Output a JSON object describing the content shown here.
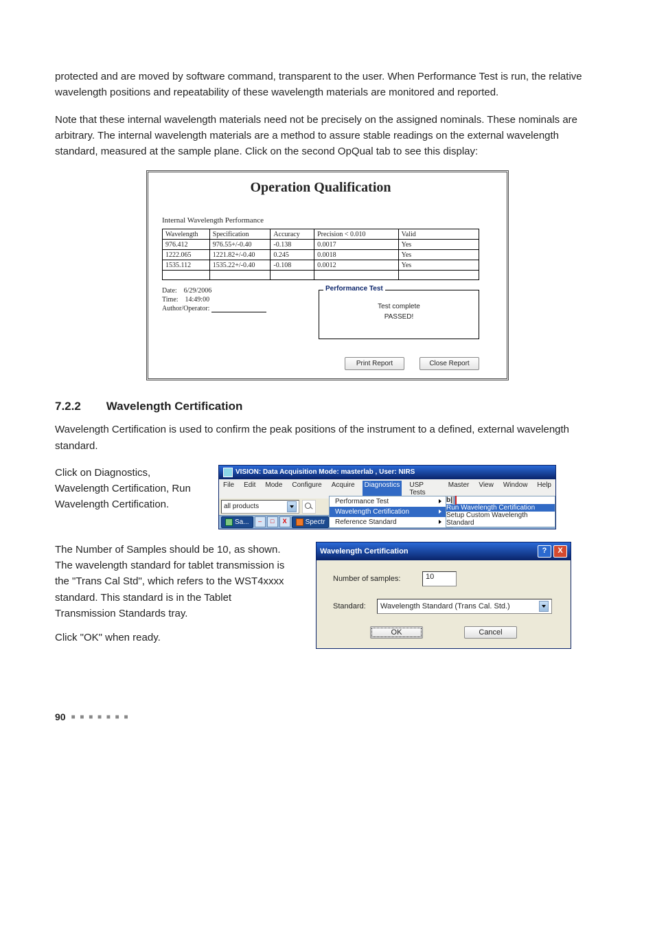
{
  "paragraphs": {
    "p1": "protected and are moved by software command, transparent to the user. When Performance Test is run, the relative wavelength positions and repeatability of these wavelength materials are monitored and reported.",
    "p2": "Note that these internal wavelength materials need not be precisely on the assigned nominals. These nominals are arbitrary. The internal wavelength materials are a method to assure stable readings on the external wavelength standard, measured at the sample plane. Click on the second OpQual tab to see this display:"
  },
  "opqual": {
    "title": "Operation Qualification",
    "section": "Internal Wavelength Performance",
    "headers": {
      "wavelength": "Wavelength",
      "specification": "Specification",
      "accuracy": "Accuracy",
      "precision": "Precision <   0.010",
      "valid": "Valid"
    },
    "rows": [
      {
        "w": "976.412",
        "s": "976.55+/-0.40",
        "a": "-0.138",
        "p": "0.0017",
        "v": "Yes"
      },
      {
        "w": "1222.065",
        "s": "1221.82+/-0.40",
        "a": "0.245",
        "p": "0.0018",
        "v": "Yes"
      },
      {
        "w": "1535.112",
        "s": "1535.22+/-0.40",
        "a": "-0.108",
        "p": "0.0012",
        "v": "Yes"
      }
    ],
    "meta": {
      "date_label": "Date:",
      "date_value": "6/29/2006",
      "time_label": "Time:",
      "time_value": "14:49:00",
      "author_label": "Author/Operator:"
    },
    "perfbox": {
      "legend": "Performance Test",
      "line1": "Test complete",
      "line2": "PASSED!"
    },
    "buttons": {
      "print": "Print Report",
      "close": "Close Report"
    }
  },
  "heading": {
    "num": "7.2.2",
    "text": "Wavelength Certification"
  },
  "para3": "Wavelength Certification is used to confirm the peak positions of the instrument to a defined, external wavelength standard.",
  "para4": "Click on Diagnostics, Wavelength Certification, Run Wavelength Certification.",
  "vision": {
    "title": "VISION: Data Acquisition Mode: masterlab , User: NIRS",
    "menu": [
      "File",
      "Edit",
      "Mode",
      "Configure",
      "Acquire",
      "Diagnostics",
      "USP Tests",
      "Master",
      "View",
      "Window",
      "Help"
    ],
    "combo_value": "all products",
    "submenu": {
      "items": [
        {
          "label": "Performance Test",
          "has_arrow": true,
          "selected": false
        },
        {
          "label": "Wavelength Certification",
          "has_arrow": true,
          "selected": true
        },
        {
          "label": "Reference Standard",
          "has_arrow": true,
          "selected": false
        }
      ]
    },
    "submenu2": {
      "items": [
        {
          "label": "Run Wavelength Certification",
          "selected": true
        },
        {
          "label": "Setup Custom Wavelength Standard",
          "selected": false
        }
      ]
    },
    "bottom_tabs": {
      "sa": "Sa...",
      "spectr": "Spectr"
    }
  },
  "para5": "The Number of Samples should be 10, as shown. The wavelength standard for tablet transmission is the \"Trans Cal Std\", which refers to the WST4xxxx standard. This standard is in the Tablet Transmission Standards tray.",
  "para6": "Click \"OK\" when ready.",
  "wcert": {
    "title": "Wavelength Certification",
    "samples_label": "Number of samples:",
    "samples_value": "10",
    "standard_label": "Standard:",
    "standard_value": "Wavelength Standard (Trans Cal. Std.)",
    "ok": "OK",
    "cancel": "Cancel"
  },
  "footer": {
    "page": "90",
    "dots": "■ ■ ■ ■ ■ ■ ■"
  }
}
